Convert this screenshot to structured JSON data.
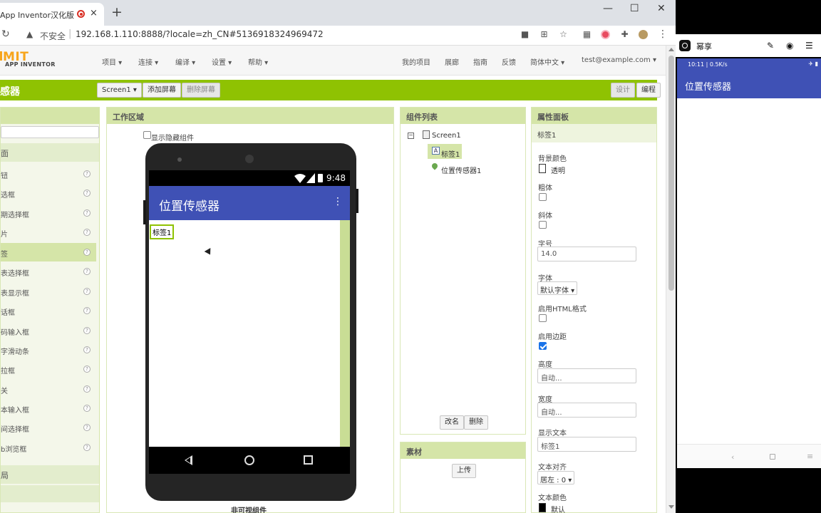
{
  "browser": {
    "tab_title": "App Inventor汉化版",
    "tab_close": "×",
    "new_tab": "+",
    "win_minimize": "—",
    "win_maximize": "☐",
    "win_close": "✕",
    "insecure_label": "不安全",
    "url": "192.168.1.110:8888/?locale=zh_CN#5136918324969472"
  },
  "ai": {
    "logo_main": "MIT",
    "logo_sub": "APP INVENTOR",
    "menus": [
      "项目 ▾",
      "连接 ▾",
      "编译 ▾",
      "设置 ▾",
      "帮助 ▾"
    ],
    "right_links": [
      "我的项目",
      "展廊",
      "指南",
      "反馈",
      "简体中文 ▾",
      "test@example.com ▾"
    ],
    "project_name": "感器",
    "screen_dropdown": "Screen1 ▾",
    "add_screen": "添加屏幕",
    "remove_screen": "删除屏幕",
    "designer_button": "设计",
    "blocks_button": "编程"
  },
  "palette": {
    "category_top": "面",
    "items": [
      "钮",
      "选框",
      "期选择框",
      "片",
      "签",
      "表选择框",
      "表显示框",
      "话框",
      "码输入框",
      "字滑动条",
      "拉框",
      "关",
      "本输入框",
      "间选择框",
      "b浏览框"
    ],
    "help": "?",
    "category_bottom": "局"
  },
  "viewer": {
    "title": "工作区域",
    "show_hidden": "显示隐藏组件",
    "time": "9:48",
    "app_title": "位置传感器",
    "overflow": "⋮",
    "label_text": "标签1",
    "nonvisible": "非可视组件"
  },
  "tree": {
    "title": "组件列表",
    "collapse": "−",
    "screen": "Screen1",
    "label_icon": "A",
    "label": "标签1",
    "sensor": "位置传感器1",
    "rename": "改名",
    "delete": "删除"
  },
  "media": {
    "title": "素材",
    "upload": "上传"
  },
  "props": {
    "title": "属性面板",
    "component": "标签1",
    "bg_color_label": "背景颜色",
    "bg_color_value": "透明",
    "bold_label": "粗体",
    "italic_label": "斜体",
    "font_size_label": "字号",
    "font_size_value": "14.0",
    "font_label": "字体",
    "font_value": "默认字体 ▾",
    "html_label": "启用HTML格式",
    "margin_label": "启用边距",
    "height_label": "高度",
    "height_value": "自动...",
    "width_label": "宽度",
    "width_value": "自动...",
    "text_label": "显示文本",
    "text_value": "标签1",
    "align_label": "文本对齐",
    "align_value": "居左 : 0 ▾",
    "text_color_label": "文本颜色",
    "text_color_value": "默认"
  },
  "mirror": {
    "title": "幂享",
    "status": "10:11 | 0.5K/s",
    "status_icons": "✈ ▮",
    "app_title": "位置传感器",
    "nav_back": "‹",
    "nav_menu": "≡"
  },
  "colors": {
    "ai_green": "#8fc202",
    "panel_head": "#d5e5a8",
    "app_bar": "#3f51b5"
  }
}
